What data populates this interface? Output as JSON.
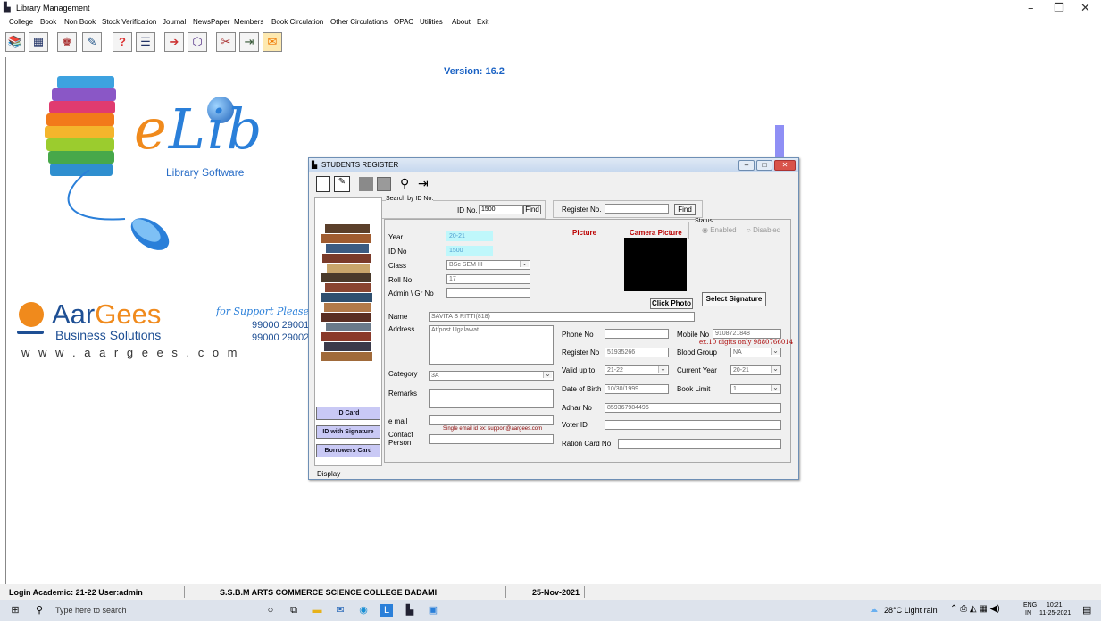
{
  "window": {
    "title": "Library Management",
    "minimize": "–",
    "maximize": "❐",
    "close": "✕"
  },
  "menu": [
    "College",
    "Book",
    "Non Book",
    "Stock Verification",
    "Journal",
    "NewsPaper",
    "Members",
    "Book Circulation",
    "Other Circulations",
    "OPAC",
    "Utilities",
    "About",
    "Exit"
  ],
  "toolbar_icons": [
    "book-icon",
    "calendar-icon",
    "person-icon",
    "pen-icon",
    "question-icon",
    "list-icon",
    "arrow-icon",
    "shield-icon",
    "tools-icon",
    "exit-icon",
    "chat-icon"
  ],
  "logo": {
    "elib_e": "e",
    "elib_rest": "Lib",
    "subtitle": "Library Software",
    "version": "Version: 16.2"
  },
  "company": {
    "name_a": "Aar",
    "name_b": "Gees",
    "tagline": "Business Solutions",
    "website": "w w w . a a r g e e s . c o m",
    "support": "for Support Please Ca",
    "phone1": "99000 29001",
    "phone2": "99000 29002"
  },
  "dialog": {
    "title": "STUDENTS REGISTER",
    "search_group": "Search by ID No.",
    "id_label": "ID No.",
    "id_value": "1500",
    "find1": "Find",
    "register_label": "Register No.",
    "register_value": "",
    "find2": "Find",
    "status_label": "Status",
    "status_enabled": "Enabled",
    "status_disabled": "Disabled",
    "picture_label": "Picture",
    "camera_label": "Camera Picture",
    "click_photo": "Click Photo",
    "select_signature": "Select Signature",
    "year_label": "Year",
    "year_value": "20-21",
    "idno_label": "ID No",
    "idno_value": "1500",
    "class_label": "Class",
    "class_value": "BSc SEM III",
    "roll_label": "Roll No",
    "roll_value": "17",
    "admin_label": "Admin \\ Gr No",
    "admin_value": "",
    "name_label": "Name",
    "name_value": "SAVITA S RITTI(818)",
    "address_label": "Address",
    "address_value": "At/post Ugalawat",
    "phone_label": "Phone No",
    "phone_value": "",
    "mobile_label": "Mobile No",
    "mobile_value": "9108721848",
    "mobile_hint": "ex.10 digits only 9880766014",
    "regno_label": "Register No",
    "regno_value": "51935266",
    "blood_label": "Blood Group",
    "blood_value": "NA",
    "category_label": "Category",
    "category_value": "3A",
    "valid_label": "Valid up to",
    "valid_value": "21-22",
    "curyear_label": "Current Year",
    "curyear_value": "20-21",
    "remarks_label": "Remarks",
    "remarks_value": "",
    "dob_label": "Date of Birth",
    "dob_value": "10/30/1999",
    "booklimit_label": "Book Limit",
    "booklimit_value": "1",
    "adhar_label": "Adhar No",
    "adhar_value": "859367984496",
    "email_label": "e mail",
    "email_value": "",
    "email_hint": "Single email id ex: support@aargees.com",
    "voter_label": "Voter ID",
    "voter_value": "",
    "contact_label": "Contact\nPerson",
    "contact_value": "",
    "ration_label": "Ration Card No",
    "ration_value": "",
    "id_card": "ID Card",
    "id_signature": "ID with Signature",
    "borrowers_card": "Borrowers Card",
    "display": "Display"
  },
  "statusbar": {
    "login": "Login Academic: 21-22 User:admin",
    "college": "S.S.B.M ARTS COMMERCE SCIENCE COLLEGE BADAMI",
    "date": "25-Nov-2021"
  },
  "taskbar": {
    "search_placeholder": "Type here to search",
    "weather": "28°C  Light rain",
    "lang1": "ENG",
    "lang2": "IN",
    "time": "10:21",
    "date": "11-25-2021"
  }
}
